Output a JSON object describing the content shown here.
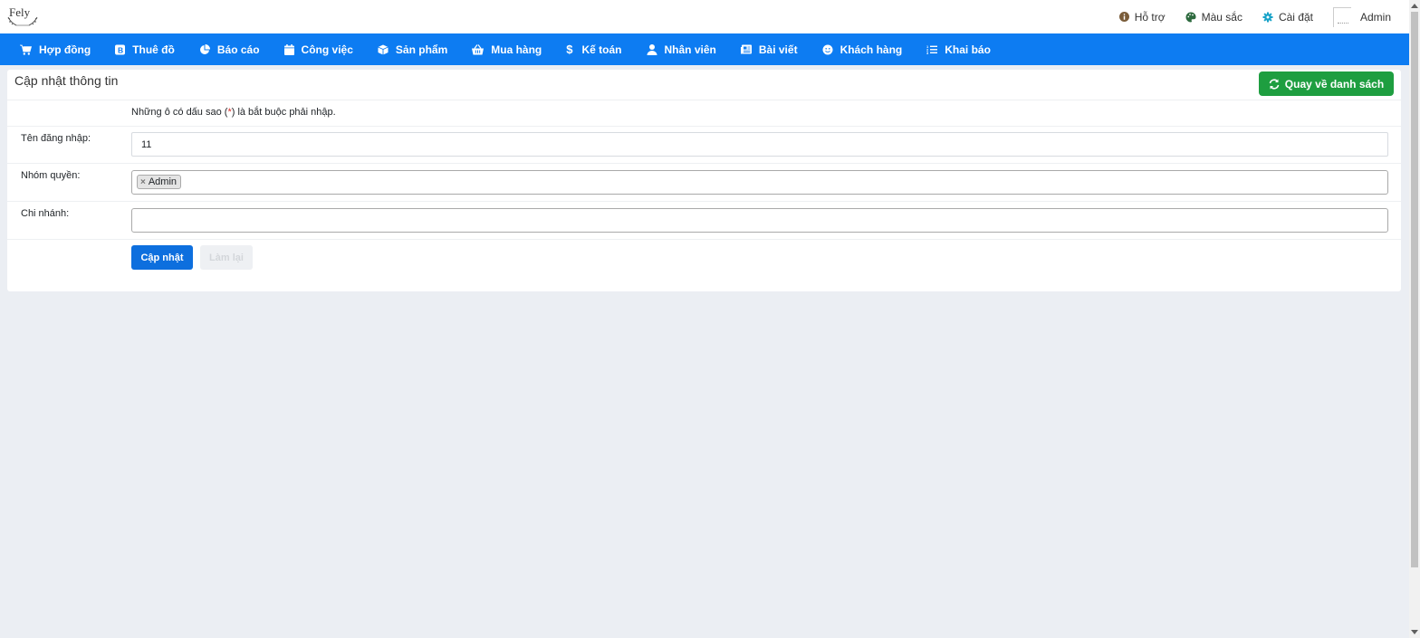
{
  "header": {
    "logo_text": "Fely",
    "links": [
      {
        "label": "Hỗ trợ",
        "icon": "info-icon",
        "color": "#7a5c3a"
      },
      {
        "label": "Màu sắc",
        "icon": "palette-icon",
        "color": "#2d6a3e"
      },
      {
        "label": "Cài đặt",
        "icon": "gear-icon",
        "color": "#17a2c8"
      },
      {
        "label": "Admin",
        "icon": "avatar"
      }
    ]
  },
  "nav": {
    "items": [
      {
        "label": "Hợp đồng",
        "icon": "cart-icon"
      },
      {
        "label": "Thuê đồ",
        "icon": "bootstrap-icon"
      },
      {
        "label": "Báo cáo",
        "icon": "pie-chart-icon"
      },
      {
        "label": "Công việc",
        "icon": "calendar-icon"
      },
      {
        "label": "Sản phẩm",
        "icon": "box-icon"
      },
      {
        "label": "Mua hàng",
        "icon": "basket-icon"
      },
      {
        "label": "Kế toán",
        "icon": "dollar-icon"
      },
      {
        "label": "Nhân viên",
        "icon": "user-icon"
      },
      {
        "label": "Bài viết",
        "icon": "newspaper-icon"
      },
      {
        "label": "Khách hàng",
        "icon": "smile-icon"
      },
      {
        "label": "Khai báo",
        "icon": "list-icon"
      }
    ],
    "color": "#0d7cf2"
  },
  "page": {
    "title": "Cập nhật thông tin",
    "back_button": "Quay về danh sách",
    "note_prefix": "Những ô có dấu sao (",
    "note_star": "*",
    "note_suffix": ") là bắt buộc phải nhập.",
    "form": {
      "username_label": "Tên đăng nhập:",
      "username_value": "11",
      "group_label": "Nhóm quyền:",
      "group_tags": [
        "Admin"
      ],
      "branch_label": "Chi nhánh:",
      "branch_value": ""
    },
    "submit_button": "Cập nhật",
    "reset_button": "Làm lại"
  }
}
